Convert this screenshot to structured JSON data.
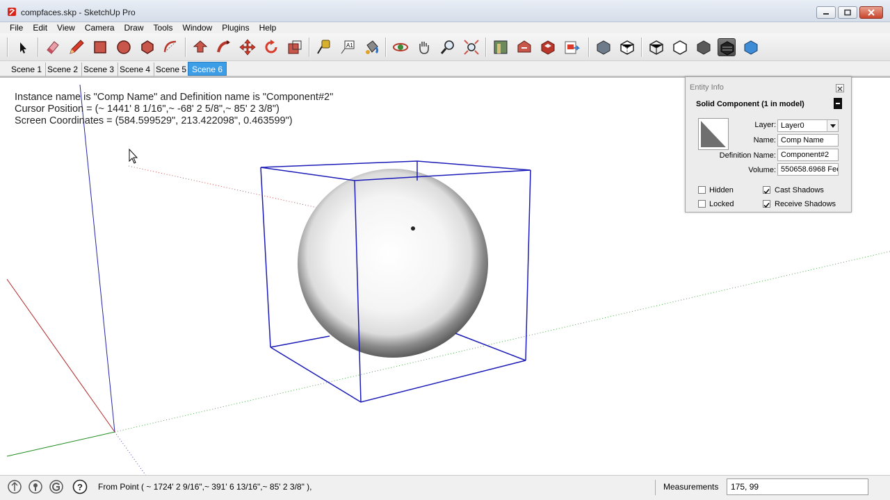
{
  "window": {
    "title": "compfaces.skp - SketchUp Pro"
  },
  "menu": [
    "File",
    "Edit",
    "View",
    "Camera",
    "Draw",
    "Tools",
    "Window",
    "Plugins",
    "Help"
  ],
  "toolbar": {
    "tools": [
      "select-icon",
      "eraser-icon",
      "pencil-icon",
      "rectangle-icon",
      "circle-icon",
      "polygon-icon",
      "arc-icon",
      "push-pull-icon",
      "follow-me-icon",
      "move-icon",
      "rotate-icon",
      "scale-icon",
      "tape-measure-icon",
      "text-icon",
      "paint-bucket-icon",
      "orbit-icon",
      "pan-icon",
      "zoom-icon",
      "zoom-extents-icon",
      "get-models-icon",
      "share-model-icon",
      "share-component-icon",
      "send-to-layout-icon",
      "xray-icon",
      "back-edges-icon",
      "wireframe-icon",
      "hidden-line-icon",
      "shaded-icon",
      "shaded-textures-icon",
      "monochrome-icon"
    ],
    "active_tool": "shaded-textures-icon"
  },
  "scenes": {
    "tabs": [
      "Scene 1",
      "Scene 2",
      "Scene 3",
      "Scene 4",
      "Scene 5",
      "Scene 6"
    ],
    "active": "Scene 6"
  },
  "viewport": {
    "info_line1": "Instance name is \"Comp Name\" and Definition name is \"Component#2\"",
    "info_line2": "Cursor Position = (~ 1441' 8 1/16\",~ -68' 2 5/8\",~ 85' 2 3/8\")",
    "info_line3": "Screen Coordinates = (584.599529\", 213.422098\", 0.463599\")",
    "selection_color": "#1a1ab8"
  },
  "entity_info": {
    "title": "Entity Info",
    "heading": "Solid Component (1 in model)",
    "layer_label": "Layer:",
    "layer_value": "Layer0",
    "name_label": "Name:",
    "name_value": "Comp Name",
    "definition_label": "Definition Name:",
    "definition_value": "Component#2",
    "volume_label": "Volume:",
    "volume_value": "550658.6968 Fee",
    "hidden_label": "Hidden",
    "hidden_checked": false,
    "cast_shadows_label": "Cast Shadows",
    "cast_shadows_checked": true,
    "locked_label": "Locked",
    "locked_checked": false,
    "receive_shadows_label": "Receive Shadows",
    "receive_shadows_checked": true
  },
  "statusbar": {
    "icons": [
      "geo-location-icon",
      "credits-icon",
      "google-sign-in-icon",
      "help-icon"
    ],
    "message": "From Point ( ~ 1724' 2 9/16\",~ 391' 6 13/16\",~ 85' 2 3/8\" ),",
    "measurements_label": "Measurements",
    "measurements_value": "175, 99"
  }
}
